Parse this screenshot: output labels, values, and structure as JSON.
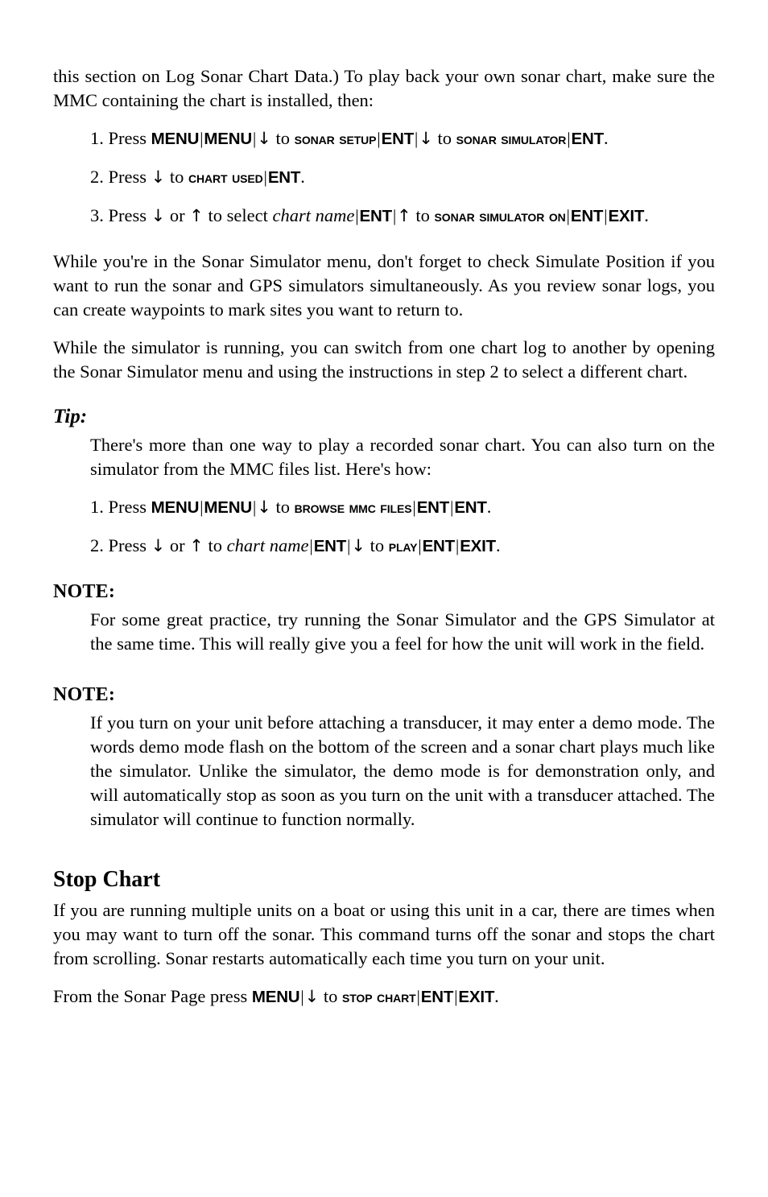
{
  "page": {
    "intro_paragraph": "this section on Log Sonar Chart Data.) To play back your own sonar chart, make sure the MMC containing the chart is installed, then:",
    "steps_group_1": [
      {
        "number": "1.",
        "lead": "Press",
        "keys": [
          "MENU",
          "MENU"
        ],
        "arrow_down": "↓",
        "to": "to",
        "label_1": "Sonar Setup",
        "key_ent_1": "ENT",
        "label_2": "Sonar Simulator",
        "key_ent_2": "ENT",
        "period": "."
      },
      {
        "number": "2.",
        "lead": "Press",
        "arrow_down": "↓",
        "to": "to",
        "label_1": "Chart Used",
        "key_ent_1": "ENT",
        "period": "."
      },
      {
        "number": "3.",
        "lead": "Press",
        "arrow_down": "↓",
        "or": "or",
        "arrow_up": "↑",
        "to": "to",
        "select": "select",
        "italic_term": "chart name",
        "key_ent_1": "ENT",
        "label_1": "Sonar Simulator On",
        "key_ent_2": "ENT",
        "key_exit": "EXIT",
        "period": "."
      }
    ],
    "paragraph_simulate": "While you're in the Sonar Simulator menu, don't forget to check Simulate Position if you want to run the sonar and GPS simulators simultaneously. As you review sonar logs, you can create waypoints to mark sites you want to return to.",
    "paragraph_switch": "While the simulator is running, you can switch from one chart log to another by opening the Sonar Simulator menu and using the instructions in step 2 to select a different chart.",
    "tip": {
      "heading": "Tip:",
      "body": "There's more than one way to play a recorded sonar chart. You can also turn on the simulator from the MMC files list. Here's how:",
      "steps": [
        {
          "number": "1.",
          "lead": "Press",
          "keys": [
            "MENU",
            "MENU"
          ],
          "arrow_down": "↓",
          "to": "to",
          "label_1": "Browse MMC Files",
          "key_ent_1": "ENT",
          "key_ent_2": "ENT",
          "period": "."
        },
        {
          "number": "2.",
          "lead": "Press",
          "arrow_down": "↓",
          "or": "or",
          "arrow_up": "↑",
          "to": "to",
          "italic_term": "chart name",
          "key_ent_1": "ENT",
          "arrow_down_2": "↓",
          "to_2": "to",
          "label_1": "Play",
          "key_ent_2": "ENT",
          "key_exit": "EXIT",
          "period": "."
        }
      ]
    },
    "note_1": {
      "heading": "NOTE:",
      "body": "For some great practice, try running the Sonar Simulator and the GPS Simulator at the same time. This will really give you a feel for how the unit will work in the field."
    },
    "note_2": {
      "heading": "NOTE:",
      "body": "If you turn on your unit before attaching a transducer, it may enter a demo mode. The words demo mode flash on the bottom of the screen and a sonar chart plays much like the simulator. Unlike the simulator, the demo mode is for demonstration only, and will automatically stop as soon as you turn on the unit with a transducer attached. The simulator will continue to function normally."
    },
    "stop_chart": {
      "heading": "Stop Chart",
      "body": "If you are running multiple units on a boat or using this unit in a car, there are times when you may want to turn off the sonar. This command turns off the sonar and stops the chart from scrolling. Sonar restarts automatically each time you turn on your unit.",
      "final_line": {
        "lead": "From the Sonar Page press",
        "key_menu": "MENU",
        "arrow_down": "↓",
        "to": "to",
        "label_1": "Stop Chart",
        "key_ent": "ENT",
        "key_exit": "EXIT",
        "period": "."
      }
    }
  }
}
